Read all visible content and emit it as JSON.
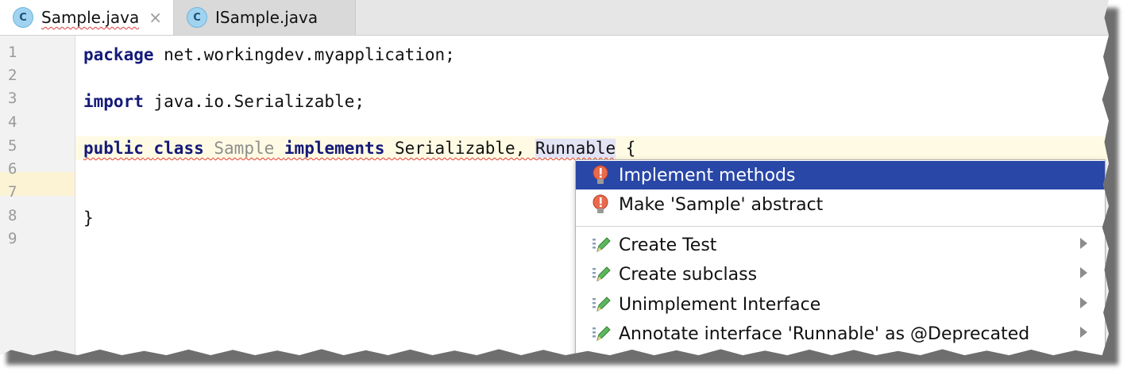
{
  "tabs": [
    {
      "label": "Sample.java",
      "icon": "java-class-icon",
      "active": true
    },
    {
      "label": "ISample.java",
      "icon": "java-class-icon",
      "active": false
    }
  ],
  "close_glyph": "×",
  "class_icon_letter": "C",
  "editor": {
    "line_numbers": [
      "1",
      "2",
      "3",
      "4",
      "5",
      "6",
      "7",
      "8",
      "9"
    ],
    "lines": {
      "l1_kw": "package",
      "l1_rest": " net.workingdev.myapplication;",
      "l3_kw": "import",
      "l3_rest": " java.io.Serializable;",
      "l5_kw1": "public",
      "l5_kw2": "class",
      "l5_name": "Sample",
      "l5_kw3": "implements",
      "l5_iface1": " Serializable, ",
      "l5_iface2": "Runnable",
      "l5_brace": " {",
      "l8": "}"
    }
  },
  "intention_menu": {
    "items": [
      {
        "label": "Implement methods",
        "icon": "red-bulb-icon",
        "selected": true,
        "submenu": false
      },
      {
        "label": "Make 'Sample' abstract",
        "icon": "red-bulb-icon",
        "selected": false,
        "submenu": false
      },
      {
        "label": "Create Test",
        "icon": "pencil-icon",
        "selected": false,
        "submenu": true
      },
      {
        "label": "Create subclass",
        "icon": "pencil-icon",
        "selected": false,
        "submenu": true
      },
      {
        "label": "Unimplement Interface",
        "icon": "pencil-icon",
        "selected": false,
        "submenu": true
      },
      {
        "label": "Annotate interface 'Runnable' as @Deprecated",
        "icon": "pencil-icon",
        "selected": false,
        "submenu": true
      }
    ]
  },
  "colors": {
    "keyword": "#141a78",
    "selection": "#2947a6",
    "caret_line": "#fffae3",
    "error_squiggle": "#e23b3b"
  }
}
